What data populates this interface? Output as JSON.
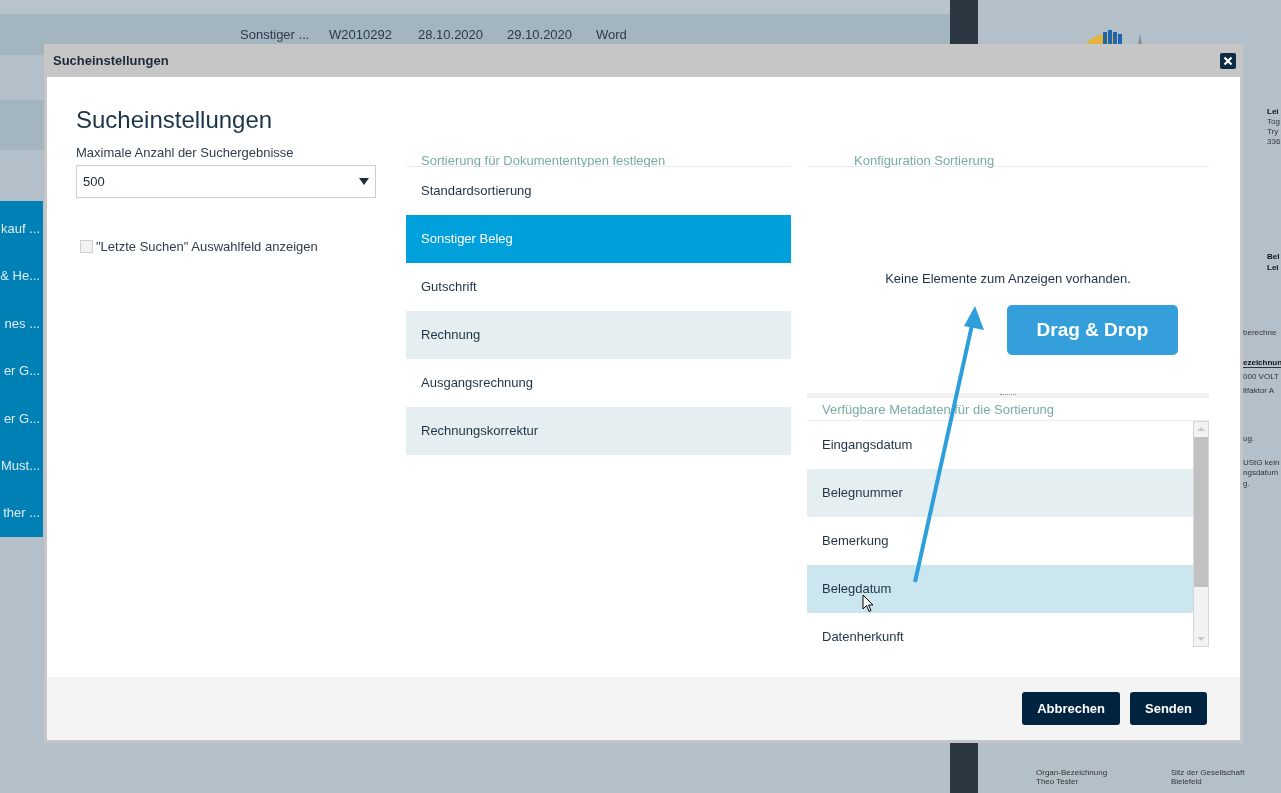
{
  "background": {
    "table_row": [
      "Sonstiger ...",
      "W2010292",
      "28.10.2020",
      "29.10.2020",
      "Word"
    ],
    "sidebar_items": [
      "kauf ...",
      "& He...",
      "nes ...",
      "er G...",
      "er G...",
      "Must...",
      "ther ..."
    ],
    "document_fragments": [
      {
        "text": "Lei",
        "kind": "bold"
      },
      {
        "text": "Tog",
        "kind": "plain"
      },
      {
        "text": "Try",
        "kind": "plain"
      },
      {
        "text": "336",
        "kind": "plain"
      },
      {
        "text": "Bel",
        "kind": "bold"
      },
      {
        "text": "Lei",
        "kind": "bold"
      },
      {
        "text": "berechne",
        "kind": "plain"
      },
      {
        "text": "ezeichnun",
        "kind": "heading"
      },
      {
        "text": "000 VOLT",
        "kind": "plain"
      },
      {
        "text": "itfaktor A",
        "kind": "plain"
      },
      {
        "text": "ug.",
        "kind": "plain"
      },
      {
        "text": "UStG kein",
        "kind": "plain"
      },
      {
        "text": "ngsdatum",
        "kind": "plain"
      },
      {
        "text": "g.",
        "kind": "plain"
      },
      {
        "text": "Organ-Bezeichnung",
        "kind": "plain"
      },
      {
        "text": "Theo Tester",
        "kind": "plain"
      },
      {
        "text": "Sitz der Gesellschaft",
        "kind": "plain"
      },
      {
        "text": "Bielefeld",
        "kind": "plain"
      }
    ]
  },
  "dialog": {
    "title": "Sucheinstellungen",
    "heading": "Sucheinstellungen",
    "max_results": {
      "label": "Maximale Anzahl der Suchergebnisse",
      "value": "500"
    },
    "recent_searches": {
      "label": "\"Letzte Suchen\" Auswahlfeld anzeigen",
      "checked": false
    },
    "document_types": {
      "header": "Sortierung für Dokumententypen festlegen",
      "items": [
        {
          "label": "Standardsortierung",
          "selected": false
        },
        {
          "label": "Sonstiger Beleg",
          "selected": true
        },
        {
          "label": "Gutschrift",
          "selected": false
        },
        {
          "label": "Rechnung",
          "selected": false
        },
        {
          "label": "Ausgangsrechnung",
          "selected": false
        },
        {
          "label": "Rechnungskorrektur",
          "selected": false
        }
      ]
    },
    "sort_config": {
      "header": "Konfiguration Sortierung",
      "empty_message": "Keine Elemente zum Anzeigen vorhanden."
    },
    "metadata": {
      "header": "Verfügbare Metadaten für die Sortierung",
      "items": [
        {
          "label": "Eingangsdatum",
          "selected": false
        },
        {
          "label": "Belegnummer",
          "selected": false
        },
        {
          "label": "Bemerkung",
          "selected": false
        },
        {
          "label": "Belegdatum",
          "selected": true
        },
        {
          "label": "Datenherkunft",
          "selected": false
        }
      ]
    },
    "buttons": [
      "Abbrechen",
      "Senden"
    ]
  },
  "annotation": {
    "label": "Drag & Drop"
  }
}
